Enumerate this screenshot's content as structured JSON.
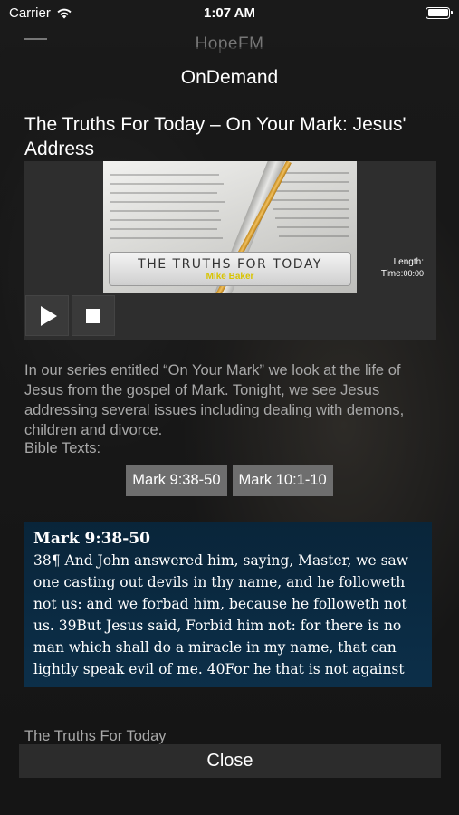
{
  "status_bar": {
    "carrier": "Carrier",
    "time": "1:07 AM"
  },
  "app": {
    "title": "HopeFM"
  },
  "sheet": {
    "title": "OnDemand"
  },
  "episode": {
    "title": "The Truths For Today – On Your Mark: Jesus' Address",
    "art_title": "THE TRUTHS FOR TODAY",
    "art_subtitle": "Mike Baker",
    "length_label": "Length:",
    "time_label": "Time:",
    "time_value": "00:00",
    "description": "In our series entitled “On Your Mark” we look at the life of Jesus from the gospel of Mark. Tonight, we see Jesus addressing several issues including dealing with demons, children and divorce.",
    "bible_texts_label": "Bible Texts:",
    "bible_texts": [
      "Mark 9:38-50",
      "Mark 10:1-10"
    ]
  },
  "scripture": {
    "reference": "Mark 9:38-50",
    "text": "38¶ And John answered him, saying, Master, we saw one casting out devils in thy name, and he followeth not us: and we forbad him, because he followeth not us. 39But Jesus said, Forbid him not: for there is no man which shall do a miracle in my name, that can lightly speak evil of me. 40For he that is not against us"
  },
  "footer": {
    "program": "The Truths For Today",
    "close_label": "Close"
  },
  "colors": {
    "scripture_bg": "#0c2f49",
    "button_bg": "#6e6e6e"
  }
}
